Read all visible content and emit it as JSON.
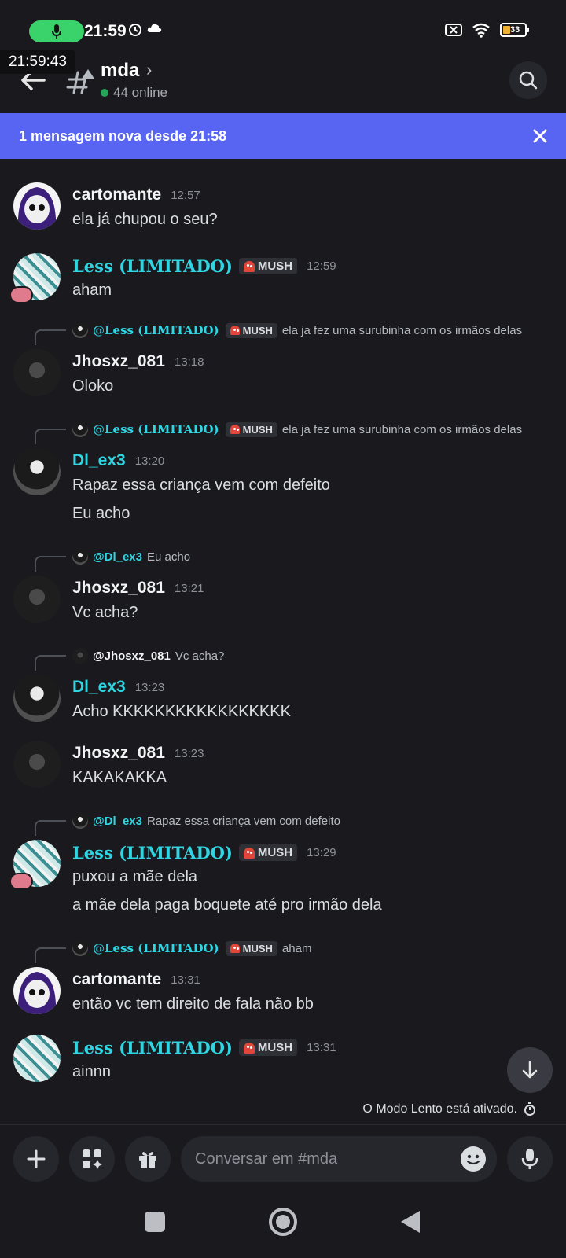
{
  "status_bar": {
    "time": "21:59",
    "battery": "33"
  },
  "overlay_time": "21:59:43",
  "header": {
    "channel": "mda",
    "online": "44 online"
  },
  "banner": {
    "text": "1 mensagem nova desde 21:58"
  },
  "badges": {
    "mush": "MUSH"
  },
  "messages": [
    {
      "author": "cartomante",
      "time": "12:57",
      "lines": [
        "ela já chupou o seu?"
      ]
    },
    {
      "author": "Less (LIMITADO)",
      "time": "12:59",
      "lines": [
        "aham"
      ]
    },
    {
      "reply_to": "@Less (LIMITADO)",
      "reply_text": "ela ja fez uma surubinha com os irmãos delas",
      "author": "Jhosxz_081",
      "time": "13:18",
      "lines": [
        "Oloko"
      ]
    },
    {
      "reply_to": "@Less (LIMITADO)",
      "reply_text": "ela ja fez uma surubinha com os irmãos delas",
      "author": "Dl_ex3",
      "time": "13:20",
      "lines": [
        "Rapaz essa criança vem com defeito",
        "Eu acho"
      ]
    },
    {
      "reply_to": "@Dl_ex3",
      "reply_text": "Eu acho",
      "author": "Jhosxz_081",
      "time": "13:21",
      "lines": [
        "Vc acha?"
      ]
    },
    {
      "reply_to": "@Jhosxz_081",
      "reply_text": "Vc acha?",
      "author": "Dl_ex3",
      "time": "13:23",
      "lines": [
        "Acho KKKKKKKKKKKKKKKKK"
      ]
    },
    {
      "author": "Jhosxz_081",
      "time": "13:23",
      "lines": [
        "KAKAKAKKA"
      ]
    },
    {
      "reply_to": "@Dl_ex3",
      "reply_text": "Rapaz essa criança vem com defeito",
      "author": "Less (LIMITADO)",
      "time": "13:29",
      "lines": [
        "puxou a mãe dela",
        "a mãe dela paga boquete até pro irmão dela"
      ]
    },
    {
      "reply_to": "@Less (LIMITADO)",
      "reply_text": "aham",
      "author": "cartomante",
      "time": "13:31",
      "lines": [
        "então vc tem direito de fala não bb"
      ]
    },
    {
      "author": "Less (LIMITADO)",
      "time": "13:31",
      "lines": [
        "ainnn"
      ]
    }
  ],
  "slow_mode": "O Modo Lento está ativado.",
  "composer": {
    "placeholder": "Conversar em #mda"
  },
  "colors": {
    "accent": "#5865f2",
    "cyan": "#2ed5e3",
    "online": "#23a55a",
    "bg": "#1a1a1e"
  }
}
